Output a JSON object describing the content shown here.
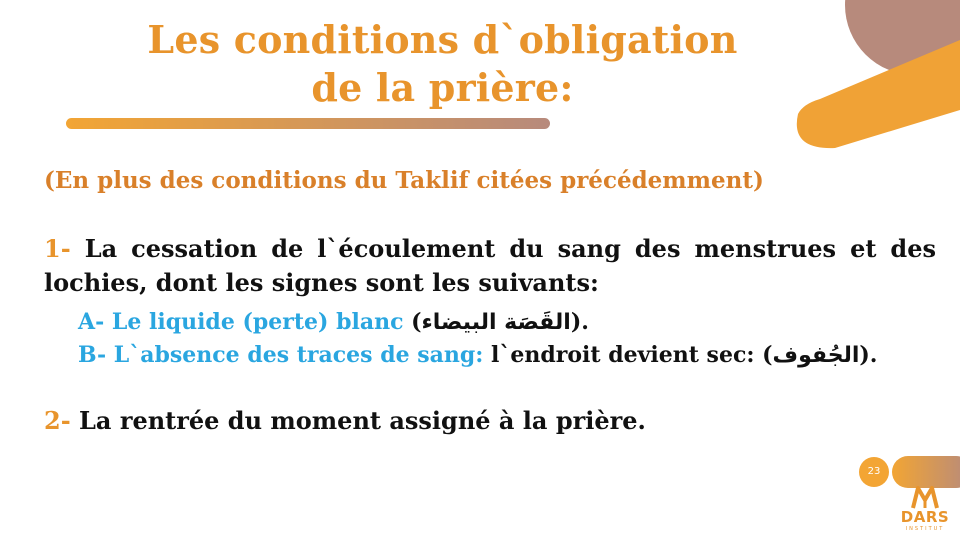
{
  "colors": {
    "accent_orange": "#e8942c",
    "accent_blue": "#2aa6e0",
    "brown": "#b78a7c",
    "text": "#111111"
  },
  "title": {
    "line1": "Les conditions d`obligation",
    "line2": "de la prière:"
  },
  "subtitle": "(En plus des conditions du Taklif citées précédemment)",
  "items": [
    {
      "num": "1-",
      "text": "La cessation de l`écoulement du sang des menstrues et des lochies, dont les signes sont les suivants:"
    },
    {
      "num": "2-",
      "text": "La rentrée du moment assigné à la prière."
    }
  ],
  "subitems": [
    {
      "label": "A- Le liquide (perte) blanc",
      "pre": " (",
      "arabic": "القَصَة البيضاء",
      "post": ")."
    },
    {
      "label": "B- L`absence des traces de sang:",
      "pre": " l`endroit devient sec: (",
      "arabic": "الجُفوف",
      "post": ")."
    }
  ],
  "page_number": "23",
  "logo": {
    "text": "DARS",
    "subtext": "INSTITUT",
    "icon": "dars-logo-icon"
  }
}
